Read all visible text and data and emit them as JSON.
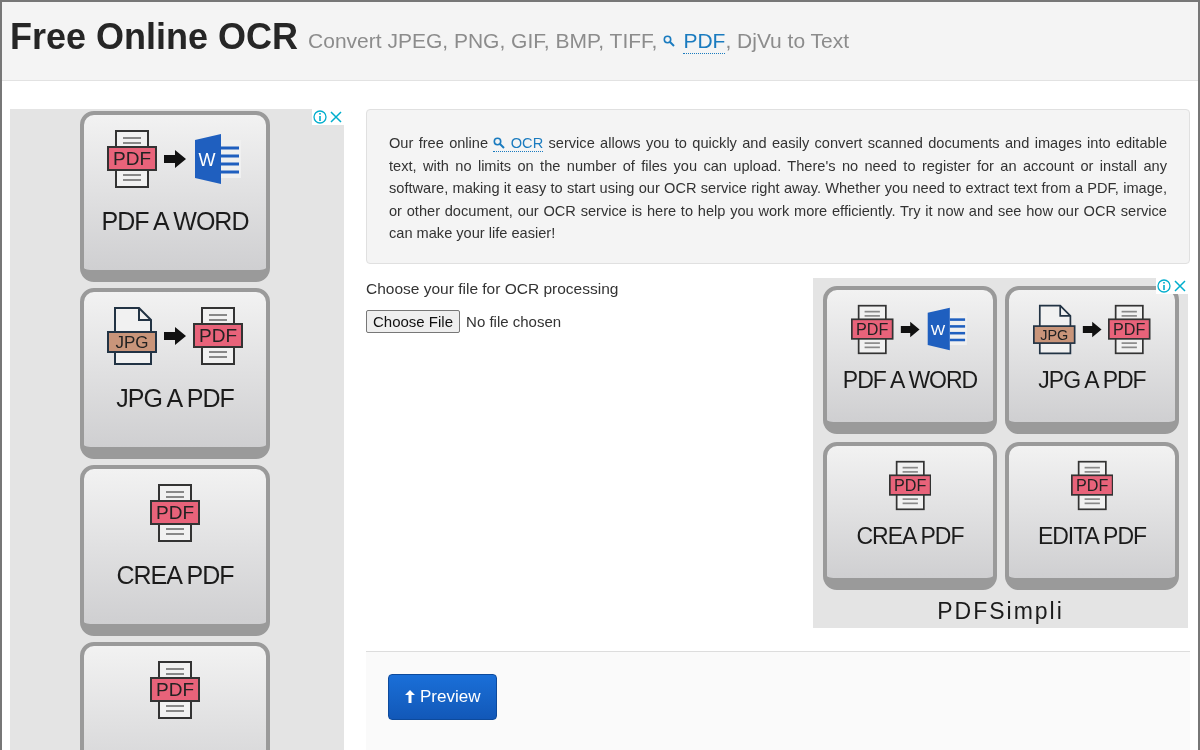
{
  "header": {
    "title": "Free Online OCR",
    "subtitle_before": "Convert JPEG, PNG, GIF, BMP, TIFF,",
    "subtitle_link": "PDF",
    "subtitle_after": ", DjVu to Text"
  },
  "left_ad": {
    "tiles": [
      {
        "label": "PDF A WORD",
        "icons": [
          {
            "kind": "pdf",
            "text": "PDF"
          },
          {
            "kind": "arrow"
          },
          {
            "kind": "word",
            "text": "W"
          }
        ]
      },
      {
        "label": "JPG A PDF",
        "icons": [
          {
            "kind": "jpg",
            "text": "JPG"
          },
          {
            "kind": "arrow"
          },
          {
            "kind": "pdf",
            "text": "PDF"
          }
        ]
      },
      {
        "label": "CREA PDF",
        "icons": [
          {
            "kind": "pdf",
            "text": "PDF"
          }
        ]
      },
      {
        "icons": [
          {
            "kind": "pdf",
            "text": "PDF"
          }
        ]
      }
    ]
  },
  "intro": {
    "before": "Our free online",
    "link": "OCR",
    "after": "service allows you to quickly and easily convert scanned documents and images into editable text, with no limits on the number of files you can upload. There's no need to register for an account or install any software, making it easy to start using our OCR service right away. Whether you need to extract text from a PDF, image, or other document, our OCR service is here to help you work more efficiently. Try it now and see how our OCR service can make your life easier!"
  },
  "upload": {
    "label": "Choose your file for OCR processing",
    "button": "Choose File",
    "status": "No file chosen"
  },
  "right_ad": {
    "tiles": [
      {
        "label": "PDF A WORD",
        "icons": [
          {
            "kind": "pdf",
            "text": "PDF"
          },
          {
            "kind": "arrow"
          },
          {
            "kind": "word",
            "text": "W"
          }
        ]
      },
      {
        "label": "JPG A PDF",
        "icons": [
          {
            "kind": "jpg",
            "text": "JPG"
          },
          {
            "kind": "arrow"
          },
          {
            "kind": "pdf",
            "text": "PDF"
          }
        ]
      },
      {
        "label": "CREA PDF",
        "icons": [
          {
            "kind": "pdf",
            "text": "PDF"
          }
        ]
      },
      {
        "label": "EDITA PDF",
        "icons": [
          {
            "kind": "pdf",
            "text": "PDF"
          }
        ]
      }
    ],
    "brand": "PDFSimpli"
  },
  "preview_button": {
    "label": "Preview"
  }
}
